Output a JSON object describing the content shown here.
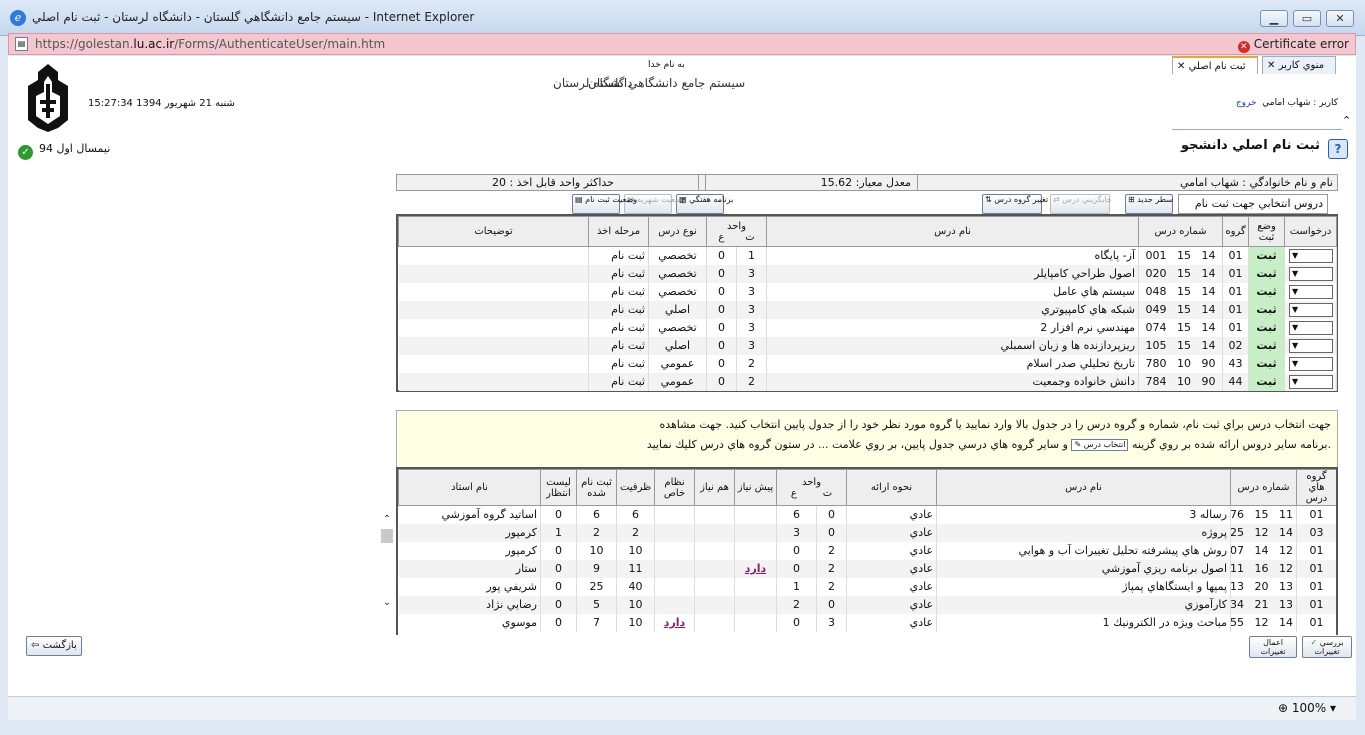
{
  "window": {
    "title": "سيستم جامع دانشگاهي گلستان - دانشگاه لرستان - ثبت نام اصلي - Internet Explorer",
    "url_prefix": "https://golestan.",
    "url_domain": "lu.ac.ir",
    "url_suffix": "/Forms/AuthenticateUser/main.htm",
    "cert_error": "Certificate error",
    "zoom": "100%"
  },
  "header": {
    "bismillah": "به نام خدا",
    "system_name": "سيستم جامع دانشگاهي گلستان",
    "university": "دانشگاه لرستان",
    "datetime": "15:27:34 شنبه 21 شهريور 1394",
    "semester": "نيمسال اول 94",
    "user_label": "كاربر : شهاب امامي",
    "logout": "خروج"
  },
  "tabs": [
    {
      "label": "منوي كاربر"
    },
    {
      "label": "ثبت نام اصلي"
    }
  ],
  "page_title": "ثبت نام اصلي دانشجو",
  "info": {
    "name": "نام و نام خانوادگي : شهاب  امامي",
    "gpa": "معدل معيار: 15.62",
    "max_units": "حداكثر واحد قابل اخذ : 20"
  },
  "toolbar": {
    "selected_courses": "دروس انتخابي جهت ثبت نام",
    "new_row": "سطر جديد",
    "swap": "جايگزيني درس",
    "change_group": "تغيير گروه درس",
    "weekly_program": "برنامه هفتگي",
    "tuition_status": "وضعيت شهريه",
    "reg_status": "وضعيت ثبت نام"
  },
  "table1": {
    "headers": {
      "request": "درخواست",
      "status": "وضع ثبت",
      "group": "گروه",
      "course_no": "شماره درس",
      "course_name": "نام درس",
      "units": "واحد",
      "units_t": "ت",
      "units_a": "ع",
      "type": "نوع درس",
      "stage": "مرحله اخذ",
      "notes": "توضيحات"
    },
    "rows": [
      {
        "status": "ثبت",
        "group": "01",
        "c1": "14",
        "c2": "15",
        "c3": "001",
        "name": "آز- پايگاه",
        "t": "1",
        "a": "0",
        "type": "تخصصي",
        "stage": "ثبت نام"
      },
      {
        "status": "ثبت",
        "group": "01",
        "c1": "14",
        "c2": "15",
        "c3": "020",
        "name": "اصول طراحي كامپايلر",
        "t": "3",
        "a": "0",
        "type": "تخصصي",
        "stage": "ثبت نام"
      },
      {
        "status": "ثبت",
        "group": "01",
        "c1": "14",
        "c2": "15",
        "c3": "048",
        "name": "سيستم هاي عامل",
        "t": "3",
        "a": "0",
        "type": "تخصصي",
        "stage": "ثبت نام"
      },
      {
        "status": "ثبت",
        "group": "01",
        "c1": "14",
        "c2": "15",
        "c3": "049",
        "name": "شبكه هاي كامپيوتري",
        "t": "3",
        "a": "0",
        "type": "اصلي",
        "stage": "ثبت نام"
      },
      {
        "status": "ثبت",
        "group": "01",
        "c1": "14",
        "c2": "15",
        "c3": "074",
        "name": "مهندسي نرم افزار 2",
        "t": "3",
        "a": "0",
        "type": "تخصصي",
        "stage": "ثبت نام"
      },
      {
        "status": "ثبت",
        "group": "02",
        "c1": "14",
        "c2": "15",
        "c3": "105",
        "name": "ريزپردازنده ها و زبان اسمبلي",
        "t": "3",
        "a": "0",
        "type": "اصلي",
        "stage": "ثبت نام"
      },
      {
        "status": "ثبت",
        "group": "43",
        "c1": "90",
        "c2": "10",
        "c3": "780",
        "name": "تاريخ تحليلي صدر اسلام",
        "t": "2",
        "a": "0",
        "type": "عمومي",
        "stage": "ثبت نام"
      },
      {
        "status": "ثبت",
        "group": "44",
        "c1": "90",
        "c2": "10",
        "c3": "784",
        "name": "دانش خانواده وجمعيت",
        "t": "2",
        "a": "0",
        "type": "عمومي",
        "stage": "ثبت نام"
      }
    ]
  },
  "notice": {
    "line1": "جهت انتخاب درس براي ثبت نام، شماره و گروه درس را در جدول بالا وارد نماييد يا گروه مورد نظر خود را از جدول پايين انتخاب كنيد. جهت مشاهده",
    "line2a": "برنامه ساير دروس ارائه شده بر روي گزينه",
    "btn": "انتخاب درس",
    "line2b": "و ساير گروه هاي درسي جدول پايين، بر روي علامت ... در ستون گروه هاي درس كليك نماييد."
  },
  "table2": {
    "headers": {
      "groups": "گروه هاي درس",
      "course_no": "شماره درس",
      "course_name": "نام درس",
      "delivery": "نحوه ارائه",
      "units": "واحد",
      "units_t": "ت",
      "units_a": "ع",
      "prereq": "پيش نياز",
      "coreq": "هم نياز",
      "special": "نظام خاص",
      "capacity": "ظرفيت",
      "enrolled": "ثبت نام شده",
      "waitlist": "ليست انتظار",
      "teacher": "نام استاد"
    },
    "rows": [
      {
        "group": "01",
        "c1": "11",
        "c2": "15",
        "c3": "776",
        "name": "رساله 3",
        "delivery": "عادي",
        "t": "0",
        "a": "6",
        "prereq": "",
        "coreq": "",
        "special": "",
        "cap": "6",
        "enr": "6",
        "wait": "0",
        "teacher": "اساتيد گروه آموزشي"
      },
      {
        "group": "03",
        "c1": "14",
        "c2": "12",
        "c3": "025",
        "name": "پروژه",
        "delivery": "عادي",
        "t": "0",
        "a": "3",
        "prereq": "",
        "coreq": "",
        "special": "",
        "cap": "2",
        "enr": "2",
        "wait": "1",
        "teacher": "كرمپور"
      },
      {
        "group": "01",
        "c1": "12",
        "c2": "14",
        "c3": "807",
        "name": "روش هاي پيشرفته تحليل تغييرات آب و هوايي",
        "delivery": "عادي",
        "t": "2",
        "a": "0",
        "prereq": "",
        "coreq": "",
        "special": "",
        "cap": "10",
        "enr": "10",
        "wait": "0",
        "teacher": "كرمپور"
      },
      {
        "group": "01",
        "c1": "12",
        "c2": "16",
        "c3": "711",
        "name": "اصول برنامه ريزي آموزشي",
        "delivery": "عادي",
        "t": "2",
        "a": "0",
        "prereq": "دارد",
        "coreq": "",
        "special": "",
        "cap": "11",
        "enr": "9",
        "wait": "0",
        "teacher": "ستار"
      },
      {
        "group": "01",
        "c1": "13",
        "c2": "20",
        "c3": "013",
        "name": "پمپها و ايستگاهاي پمپاژ",
        "delivery": "عادي",
        "t": "2",
        "a": "1",
        "prereq": "",
        "coreq": "",
        "special": "",
        "cap": "40",
        "enr": "25",
        "wait": "0",
        "teacher": "شريفي پور"
      },
      {
        "group": "01",
        "c1": "13",
        "c2": "21",
        "c3": "134",
        "name": "كارآموزي",
        "delivery": "عادي",
        "t": "0",
        "a": "2",
        "prereq": "",
        "coreq": "",
        "special": "",
        "cap": "10",
        "enr": "5",
        "wait": "0",
        "teacher": "رضايي نژاد"
      },
      {
        "group": "01",
        "c1": "14",
        "c2": "12",
        "c3": "755",
        "name": "مباحث ويژه در الكترونيك 1",
        "delivery": "عادي",
        "t": "3",
        "a": "0",
        "prereq": "",
        "coreq": "",
        "special": "دارد",
        "cap": "10",
        "enr": "7",
        "wait": "0",
        "teacher": "موسوي"
      }
    ]
  },
  "footer": {
    "back": "بازگشت",
    "apply": "اعمال تغييرات",
    "review": "بررسي تغييرات"
  }
}
